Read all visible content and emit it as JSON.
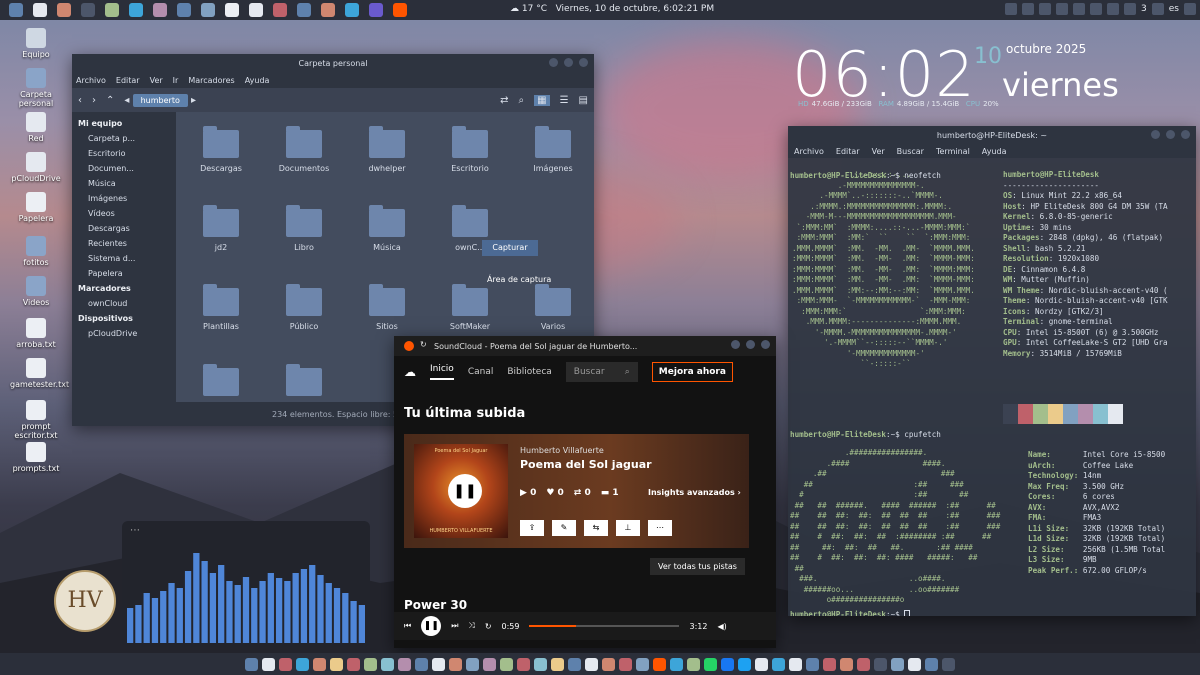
{
  "top_panel": {
    "weather_temp": "17 °C",
    "datetime": "Viernes, 10 de octubre, 6:02:21 PM",
    "tray_battery": "3",
    "tray_locale": "es"
  },
  "desktop_icons": [
    {
      "label": "Equipo"
    },
    {
      "label": "Carpeta personal"
    },
    {
      "label": "Red"
    },
    {
      "label": "pCloudDrive"
    },
    {
      "label": "Papelera"
    },
    {
      "label": "fotitos"
    },
    {
      "label": "Videos"
    },
    {
      "label": "arroba.txt"
    },
    {
      "label": "gametester.txt"
    },
    {
      "label": "prompt escritor.txt"
    },
    {
      "label": "prompts.txt"
    }
  ],
  "clock": {
    "time": "06:02",
    "day": "10",
    "month_year": "octubre 2025",
    "weekday": "viernes",
    "hd_label": "HD",
    "hd_value": "47.6GiB / 233GiB",
    "ram_label": "RAM",
    "ram_value": "4.89GiB / 15.4GiB",
    "cpu_label": "CPU",
    "cpu_value": "20%"
  },
  "file_manager": {
    "title": "Carpeta personal",
    "menu": [
      "Archivo",
      "Editar",
      "Ver",
      "Ir",
      "Marcadores",
      "Ayuda"
    ],
    "path": "humberto",
    "sidebar": {
      "section_equipo": "Mi equipo",
      "equipo_items": [
        "Carpeta p...",
        "Escritorio",
        "Documen...",
        "Música",
        "Imágenes",
        "Vídeos",
        "Descargas",
        "Recientes",
        "Sistema d...",
        "Papelera"
      ],
      "section_marcadores": "Marcadores",
      "marcadores_items": [
        "ownCloud"
      ],
      "section_dispositivos": "Dispositivos",
      "dispositivos_items": [
        "pCloudDrive"
      ]
    },
    "folders": [
      "Descargas",
      "Documentos",
      "dwhelper",
      "Escritorio",
      "Imágenes",
      "jd2",
      "Libro",
      "Música",
      "ownC...",
      "",
      "Plantillas",
      "Público",
      "Sitios",
      "SoftMaker",
      "Varios"
    ],
    "status": "234 elementos. Espacio libre: 51..."
  },
  "terminal": {
    "title": "humberto@HP-EliteDesk: ~",
    "menu": [
      "Archivo",
      "Editar",
      "Ver",
      "Buscar",
      "Terminal",
      "Ayuda"
    ],
    "prompt": "humberto@HP-EliteDesk",
    "cmd1": ":~$ neofetch",
    "cmd2": ":~$ cpufetch",
    "cmd3": ":~$ ",
    "neofetch_logo": "             ...-:::::-...\n          .-MMMMMMMMMMMMMMM-.\n      .-MMMM`..-:::::::-..`MMMM-.\n    .:MMMM.:MMMMMMMMMMMMMMM:.MMMM:.\n   -MMM-M---MMMMMMMMMMMMMMMMMMM.MMM-\n `:MMM:MM`  :MMMM:....::-...-MMMM:MMM:`\n :MMM:MMM`  :MM:`  ``    ``  `:MMM:MMM:\n.MMM.MMMM`  :MM.  -MM.  .MM-  `MMMM.MMM.\n:MMM:MMMM`  :MM.  -MM-  .MM:  `MMMM-MMM:\n:MMM:MMMM`  :MM.  -MM-  .MM:  `MMMM:MMM:\n:MMM:MMMM`  :MM.  -MM-  .MM:  `MMMM-MMM:\n.MMM.MMMM`  :MM:--:MM:--:MM:  `MMMM.MMM.\n :MMM:MMM-  `-MMMMMMMMMMMM-`  -MMM-MMM:\n  :MMM:MMM:`                `:MMM:MMM:\n   .MMM.MMMM:--------------:MMMM.MMM.\n     '-MMMM.-MMMMMMMMMMMMMMM-.MMMM-'\n       '.-MMMM``--:::::--``MMMM-.'\n            '-MMMMMMMMMMMMM-'\n               ``-:::::-``",
    "user_host": "humberto@HP-EliteDesk",
    "separator": "---------------------",
    "neofetch_info": [
      {
        "k": "OS",
        "v": " Linux Mint 22.2 x86_64"
      },
      {
        "k": "Host",
        "v": " HP EliteDesk 800 G4 DM 35W (TA"
      },
      {
        "k": "Kernel",
        "v": " 6.8.0-85-generic"
      },
      {
        "k": "Uptime",
        "v": " 30 mins"
      },
      {
        "k": "Packages",
        "v": " 2848 (dpkg), 46 (flatpak)"
      },
      {
        "k": "Shell",
        "v": " bash 5.2.21"
      },
      {
        "k": "Resolution",
        "v": " 1920x1080"
      },
      {
        "k": "DE",
        "v": " Cinnamon 6.4.8"
      },
      {
        "k": "WM",
        "v": " Mutter (Muffin)"
      },
      {
        "k": "WM Theme",
        "v": " Nordic-bluish-accent-v40 ("
      },
      {
        "k": "Theme",
        "v": " Nordic-bluish-accent-v40 [GTK"
      },
      {
        "k": "Icons",
        "v": " Nordzy [GTK2/3]"
      },
      {
        "k": "Terminal",
        "v": " gnome-terminal"
      },
      {
        "k": "CPU",
        "v": " Intel i5-8500T (6) @ 3.500GHz"
      },
      {
        "k": "GPU",
        "v": " Intel CoffeeLake-S GT2 [UHD Gra"
      },
      {
        "k": "Memory",
        "v": " 3514MiB / 15769MiB"
      }
    ],
    "swatch_colors": [
      "#3b4252",
      "#bf616a",
      "#a3be8c",
      "#ebcb8b",
      "#81a1c1",
      "#b48ead",
      "#88c0d0",
      "#e5e9f0"
    ],
    "cpufetch_logo": "            .################.\n        .####                ####.\n     .##                         ###\n   ##                      :##     ###\n  #                        :##       ##\n ##   ##  ######.   ####  ######  :##      ##\n##    ##  ##:  ##:  ##  ##  ##    :##      ###\n##    ##  ##:  ##:  ##  ##  ##    :##      ###\n##    #  ##:  ##:  ##  :######## :##      ##\n##     ##:  ##:  ##   ##.       :## ####\n##    #  ##:  ##:  ##: ####   #####:   ##\n ##\n  ###.                    ..o####.\n   ######oo...            ..oo#######\n        o###############o",
    "cpufetch_info": [
      {
        "k": "Name:",
        "v": "Intel Core i5-8500"
      },
      {
        "k": "uArch:",
        "v": "Coffee Lake"
      },
      {
        "k": "Technology:",
        "v": "14nm"
      },
      {
        "k": "Max Freq:",
        "v": "3.500 GHz"
      },
      {
        "k": "Cores:",
        "v": "6 cores"
      },
      {
        "k": "AVX:",
        "v": "AVX,AVX2"
      },
      {
        "k": "FMA:",
        "v": "FMA3"
      },
      {
        "k": "L1i Size:",
        "v": "32KB (192KB Total)"
      },
      {
        "k": "L1d Size:",
        "v": "32KB (192KB Total)"
      },
      {
        "k": "L2 Size:",
        "v": "256KB (1.5MB Total"
      },
      {
        "k": "L3 Size:",
        "v": "9MB"
      },
      {
        "k": "Peak Perf.:",
        "v": "672.00 GFLOP/s"
      }
    ]
  },
  "soundcloud": {
    "title": "SoundCloud - Poema del Sol jaguar de Humberto...",
    "nav": {
      "home": "Inicio",
      "feed": "Canal",
      "library": "Biblioteca",
      "search_placeholder": "Buscar",
      "upgrade": "Mejora ahora"
    },
    "heading": "Tu última subida",
    "artist": "Humberto Villafuerte",
    "track": "Poema del Sol jaguar",
    "art_title": "Poema del Sol Jaguar",
    "art_artist": "HUMBERTO VILLAFUERTE",
    "plays": "0",
    "likes": "0",
    "reposts": "0",
    "comments": "1",
    "insights": "Insights avanzados",
    "view_all": "Ver todas tus pistas",
    "section2": "Power 30",
    "elapsed": "0:59",
    "duration": "3:12",
    "progress": 0.31,
    "accent": "#ff5500"
  },
  "capture": {
    "button": "Capturar",
    "area": "Área de captura"
  },
  "visualizer": {
    "bars": [
      0.35,
      0.38,
      0.5,
      0.45,
      0.52,
      0.6,
      0.55,
      0.72,
      0.9,
      0.82,
      0.7,
      0.78,
      0.62,
      0.58,
      0.66,
      0.55,
      0.62,
      0.7,
      0.65,
      0.62,
      0.7,
      0.74,
      0.78,
      0.68,
      0.6,
      0.55,
      0.5,
      0.42,
      0.38
    ]
  },
  "emblem": {
    "initials": "HV"
  },
  "accent_color": "#88c0d0"
}
